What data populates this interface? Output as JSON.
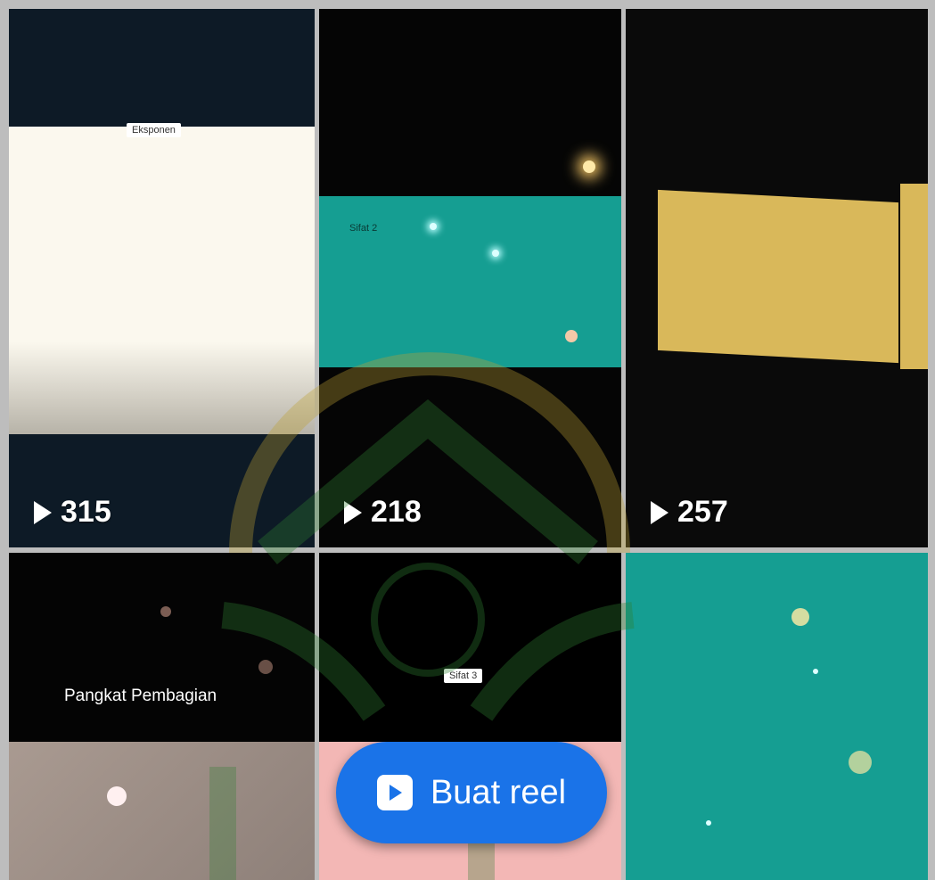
{
  "tiles": [
    {
      "view_count": "315",
      "caption": "Eksponen"
    },
    {
      "view_count": "218",
      "caption": "Sifat 2"
    },
    {
      "view_count": "257"
    },
    {
      "caption": "Pangkat Pembagian"
    },
    {
      "caption": "Sifat 3"
    },
    {}
  ],
  "create_button": {
    "label": "Buat reel",
    "icon": "reel-icon"
  },
  "colors": {
    "teal": "#159e92",
    "cream": "#fbf8ee",
    "gold": "#d9b85a",
    "button": "#1a73e8"
  }
}
